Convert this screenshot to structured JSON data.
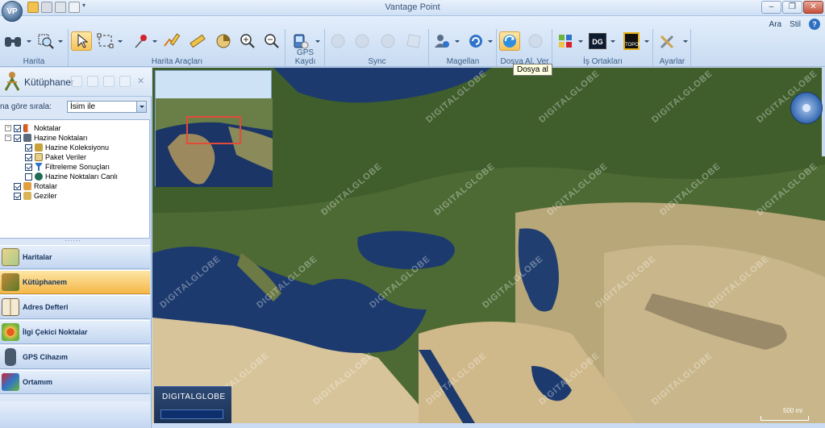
{
  "window": {
    "title": "Vantage Point",
    "app_badge": "VP"
  },
  "ribbon": {
    "right_links": [
      "Ara",
      "Stil"
    ],
    "help_label": "?",
    "groups": [
      {
        "label": "Harita"
      },
      {
        "label": "Harita Araçları"
      },
      {
        "label": "GPS Kaydı"
      },
      {
        "label": "Sync"
      },
      {
        "label": "Magellan"
      },
      {
        "label": "Dosya Al, Ver"
      },
      {
        "label": "İş Ortakları"
      },
      {
        "label": "Ayarlar"
      }
    ],
    "partner_badges": {
      "dg": "DG",
      "topo": "TOPO!"
    }
  },
  "tooltip": {
    "text": "Dosya al"
  },
  "library": {
    "title": "Kütüphaner",
    "sort_label": "na göre sırala:",
    "sort_value": "İsim ile",
    "tree": [
      {
        "label": "Noktalar",
        "level": 0,
        "checked": true,
        "expand": "-"
      },
      {
        "label": "Hazine Noktaları",
        "level": 0,
        "checked": true,
        "expand": "-"
      },
      {
        "label": "Hazine Koleksiyonu",
        "level": 1,
        "checked": true
      },
      {
        "label": "Paket Veriler",
        "level": 1,
        "checked": true
      },
      {
        "label": "Filtreleme Sonuçları",
        "level": 1,
        "checked": true
      },
      {
        "label": "Hazine Noktaları Canlı",
        "level": 1,
        "checked": false
      },
      {
        "label": "Rotalar",
        "level": 0,
        "checked": true
      },
      {
        "label": "Geziler",
        "level": 0,
        "checked": true
      }
    ]
  },
  "nav": [
    {
      "label": "Haritalar",
      "active": false
    },
    {
      "label": "Kütüphanem",
      "active": true
    },
    {
      "label": "Adres Defteri",
      "active": false
    },
    {
      "label": "İlgi Çekici Noktalar",
      "active": false
    },
    {
      "label": "GPS Cihazım",
      "active": false
    },
    {
      "label": "Ortamım",
      "active": false
    }
  ],
  "map": {
    "watermark": "DIGITALGLOBE",
    "logo_text": "DIGITALGLOBE",
    "scale_label": "500 mi"
  }
}
